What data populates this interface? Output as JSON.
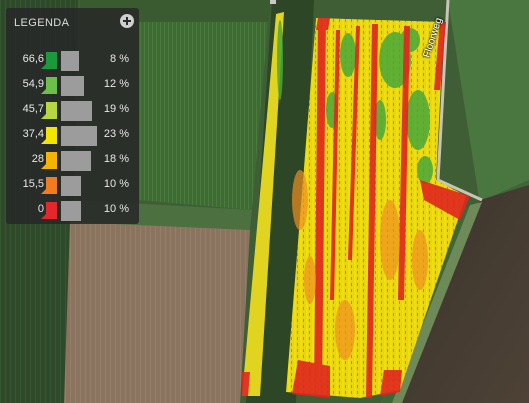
{
  "legend": {
    "title": "LEGENDA",
    "toggle_icon": "plus-circle-icon",
    "classes": [
      {
        "value": "66,6",
        "percent": "8 %",
        "share": 0.08,
        "color": "#1a9a3c"
      },
      {
        "value": "54,9",
        "percent": "12 %",
        "share": 0.12,
        "color": "#6cc04a"
      },
      {
        "value": "45,7",
        "percent": "19 %",
        "share": 0.19,
        "color": "#b8d640"
      },
      {
        "value": "37,4",
        "percent": "23 %",
        "share": 0.23,
        "color": "#f2e600"
      },
      {
        "value": "28",
        "percent": "18 %",
        "share": 0.18,
        "color": "#f5b400"
      },
      {
        "value": "15,5",
        "percent": "10 %",
        "share": 0.1,
        "color": "#f07c1e"
      },
      {
        "value": "0",
        "percent": "10 %",
        "share": 0.1,
        "color": "#e5262a"
      }
    ]
  },
  "map": {
    "road_label": "Floorweg"
  }
}
